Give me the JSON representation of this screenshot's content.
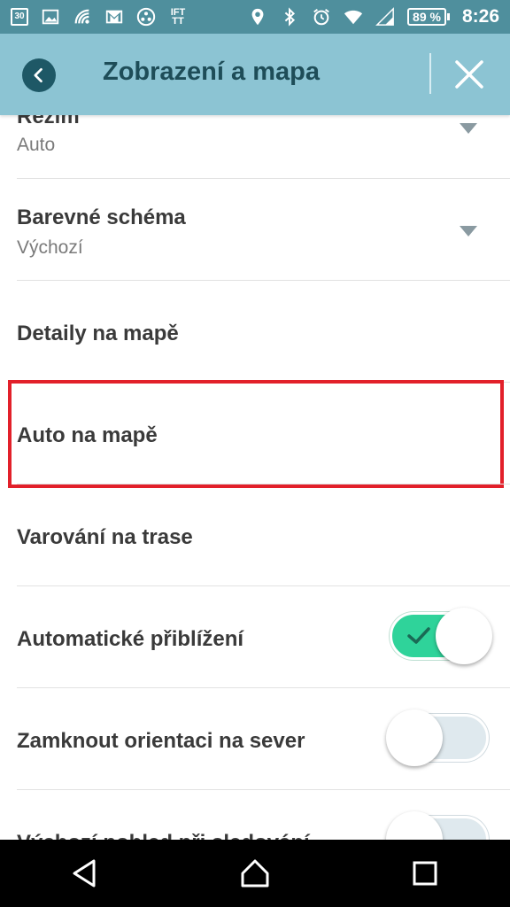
{
  "status_bar": {
    "calendar_day": "30",
    "ift_label": "IFT TT",
    "battery": "89 %",
    "clock": "8:26",
    "icons": [
      "calendar-icon",
      "image-icon",
      "wifi-calling-icon",
      "gmail-icon",
      "app-icon",
      "ifttt-icon",
      "location-icon",
      "bluetooth-icon",
      "alarm-icon",
      "wifi-icon",
      "signal-icon",
      "battery-icon"
    ]
  },
  "header": {
    "title": "Zobrazení a mapa",
    "back_icon": "chevron-left-icon",
    "close_icon": "close-icon",
    "background": "#8cc4d3"
  },
  "settings": {
    "mode": {
      "title": "Režim",
      "value": "Auto"
    },
    "color_scheme": {
      "title": "Barevné schéma",
      "value": "Výchozí"
    },
    "map_details": {
      "title": "Detaily na mapě"
    },
    "car_on_map": {
      "title": "Auto na mapě"
    },
    "route_warnings": {
      "title": "Varování na trase"
    },
    "auto_zoom": {
      "title": "Automatické přiblížení",
      "enabled": true
    },
    "lock_north": {
      "title": "Zamknout orientaci na sever",
      "enabled": false
    },
    "partial_last": {
      "title": "Výchozí pohled při sledování",
      "enabled": false
    }
  },
  "colors": {
    "toggle_on": "#2fd39a",
    "highlight": "#e2202a",
    "status_bar": "#4f8f9d"
  },
  "nav_bar": {
    "icons": [
      "back-triangle-icon",
      "home-icon",
      "recents-square-icon"
    ]
  }
}
